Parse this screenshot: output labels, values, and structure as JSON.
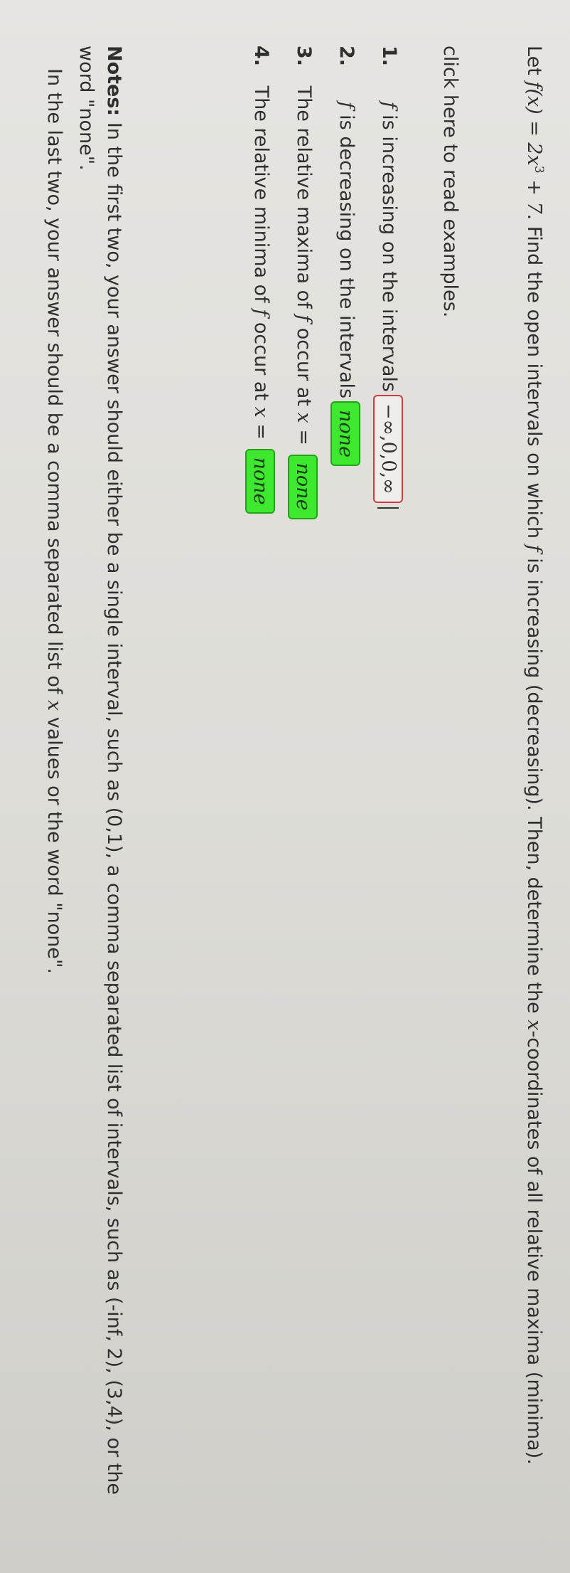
{
  "question": {
    "let": "Let ",
    "f": "f(x) = 2x",
    "exp": "3",
    "tail": " + 7",
    "text": ". Find the open intervals on which ",
    "f2": "f",
    "text2": " is increasing (decreasing). Then, determine the ",
    "x": "x",
    "text3": "-coordinates of all relative maxima (minima)."
  },
  "examples_link": "click here to read examples.",
  "items": [
    {
      "num": "1.",
      "pre_math": "f",
      "label": " is increasing on the intervals",
      "value": "−∞,0,0,∞"
    },
    {
      "num": "2.",
      "pre_math": "f",
      "label": " is decreasing on the intervals",
      "value": "none"
    },
    {
      "num": "3.",
      "label_a": "The relative maxima of ",
      "math_a": "f",
      "label_b": " occur at ",
      "math_b": "x",
      "label_c": " = ",
      "value": "none"
    },
    {
      "num": "4.",
      "label_a": "The relative minima of ",
      "math_a": "f",
      "label_b": " occur at ",
      "math_b": "x",
      "label_c": " = ",
      "value": "none"
    }
  ],
  "notes": {
    "bold": "Notes:",
    "text": " In the first two, your answer should either be a single interval, such as (0,1), a comma separated list of intervals, such as (-inf, 2), (3,4), or the word \"none\".",
    "text2a": "In the last two, your answer should be a comma separated list of ",
    "x": "x",
    "text2b": " values or the word \"none\"."
  },
  "colors": {
    "correct_bg": "#3ee82e",
    "incorrect_border": "#d63a3a"
  }
}
